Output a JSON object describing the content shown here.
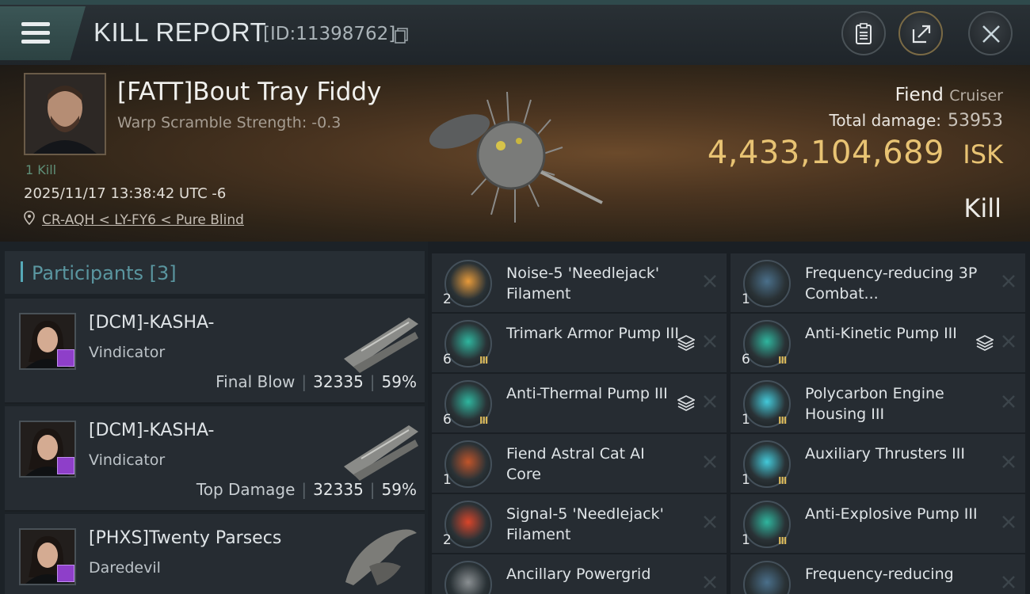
{
  "header": {
    "title": "KILL REPORT",
    "report_id": "[ID:11398762]",
    "icons": [
      "menu-icon",
      "copy-icon",
      "clipboard-icon",
      "share-icon",
      "close-icon"
    ]
  },
  "victim": {
    "name": "[FATT]Bout Tray Fiddy",
    "warp_scramble": "Warp Scramble Strength: -0.3",
    "kill_count": "1 Kill",
    "timestamp": "2025/11/17 13:38:42 UTC -6",
    "location": "CR-AQH < LY-FY6 < Pure Blind",
    "ship_name": "Fiend",
    "ship_class": "Cruiser",
    "total_damage_label": "Total damage:",
    "total_damage": "53953",
    "isk_value": "4,433,104,689",
    "isk_unit": "ISK",
    "result": "Kill"
  },
  "participants": {
    "title": "Participants [3]",
    "items": [
      {
        "name": "[DCM]-KASHA-",
        "ship": "Vindicator",
        "label": "Final Blow",
        "damage": "32335",
        "percent": "59%"
      },
      {
        "name": "[DCM]-KASHA-",
        "ship": "Vindicator",
        "label": "Top Damage",
        "damage": "32335",
        "percent": "59%"
      },
      {
        "name": "[PHXS]Twenty Parsecs",
        "ship": "Daredevil",
        "label": "",
        "damage": "",
        "percent": ""
      }
    ]
  },
  "modules": {
    "left": [
      {
        "qty": "2",
        "name": "Noise-5 'Needlejack' Filament",
        "stacked": false,
        "tier": ""
      },
      {
        "qty": "6",
        "name": "Trimark Armor Pump III",
        "stacked": true,
        "tier": "III"
      },
      {
        "qty": "6",
        "name": "Anti-Thermal Pump III",
        "stacked": true,
        "tier": "III"
      },
      {
        "qty": "1",
        "name": "Fiend Astral Cat AI Core",
        "stacked": false,
        "tier": ""
      },
      {
        "qty": "2",
        "name": "Signal-5 'Needlejack' Filament",
        "stacked": false,
        "tier": ""
      },
      {
        "qty": "",
        "name": "Ancillary Powergrid",
        "stacked": false,
        "tier": ""
      }
    ],
    "right": [
      {
        "qty": "1",
        "name": "Frequency-reducing 3P Combat...",
        "stacked": false,
        "tier": ""
      },
      {
        "qty": "6",
        "name": "Anti-Kinetic Pump III",
        "stacked": true,
        "tier": "III"
      },
      {
        "qty": "1",
        "name": "Polycarbon Engine Housing III",
        "stacked": false,
        "tier": "III"
      },
      {
        "qty": "1",
        "name": "Auxiliary Thrusters III",
        "stacked": false,
        "tier": "III"
      },
      {
        "qty": "1",
        "name": "Anti-Explosive Pump III",
        "stacked": false,
        "tier": "III"
      },
      {
        "qty": "",
        "name": "Frequency-reducing",
        "stacked": false,
        "tier": ""
      }
    ]
  },
  "colors": {
    "accent": "#56a9b8",
    "isk": "#e8c373",
    "panel": "#262c32",
    "badge": "#8e3fc9"
  }
}
